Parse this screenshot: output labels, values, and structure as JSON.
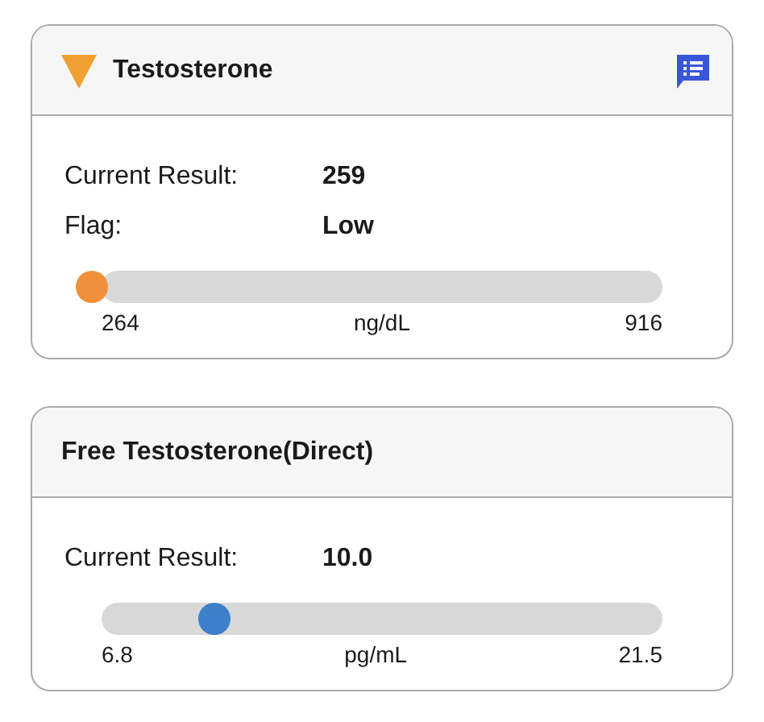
{
  "cards": [
    {
      "title": "Testosterone",
      "flag_icon": true,
      "notes_icon": true,
      "rows": [
        {
          "label": "Current Result:",
          "value": "259"
        },
        {
          "label": "Flag:",
          "value": "Low"
        }
      ],
      "range": {
        "below_range": true,
        "level": 0,
        "color": "#f0903a",
        "min": "264",
        "unit": "ng/dL",
        "max": "916"
      }
    },
    {
      "title": "Free Testosterone(Direct)",
      "flag_icon": false,
      "notes_icon": false,
      "rows": [
        {
          "label": "Current Result:",
          "value": "10.0"
        }
      ],
      "range": {
        "below_range": false,
        "level": 0.2,
        "color": "#3d7fc9",
        "min": "6.8",
        "unit": "pg/mL",
        "max": "21.5"
      }
    }
  ]
}
